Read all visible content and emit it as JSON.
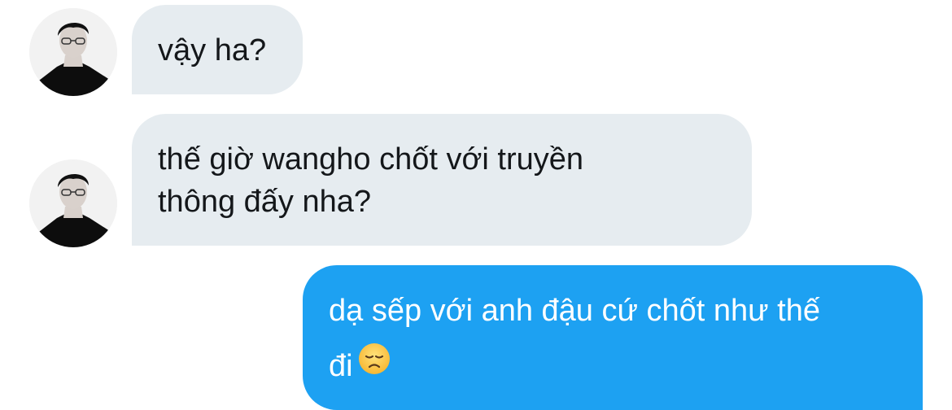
{
  "conversation": {
    "messages": [
      {
        "direction": "incoming",
        "lines": [
          "vậy ha?"
        ]
      },
      {
        "direction": "incoming",
        "lines": [
          "thế giờ wangho chốt với truyền",
          "thông đấy nha?"
        ]
      },
      {
        "direction": "outgoing",
        "lines": [
          "dạ sếp với anh đậu cứ chốt như thế",
          "đi"
        ],
        "trailing_emoji": "disappointed-face-icon"
      }
    ]
  },
  "colors": {
    "incoming_bubble": "#e6ecf0",
    "outgoing_bubble": "#1da1f2",
    "incoming_text": "#14171a",
    "outgoing_text": "#ffffff"
  }
}
